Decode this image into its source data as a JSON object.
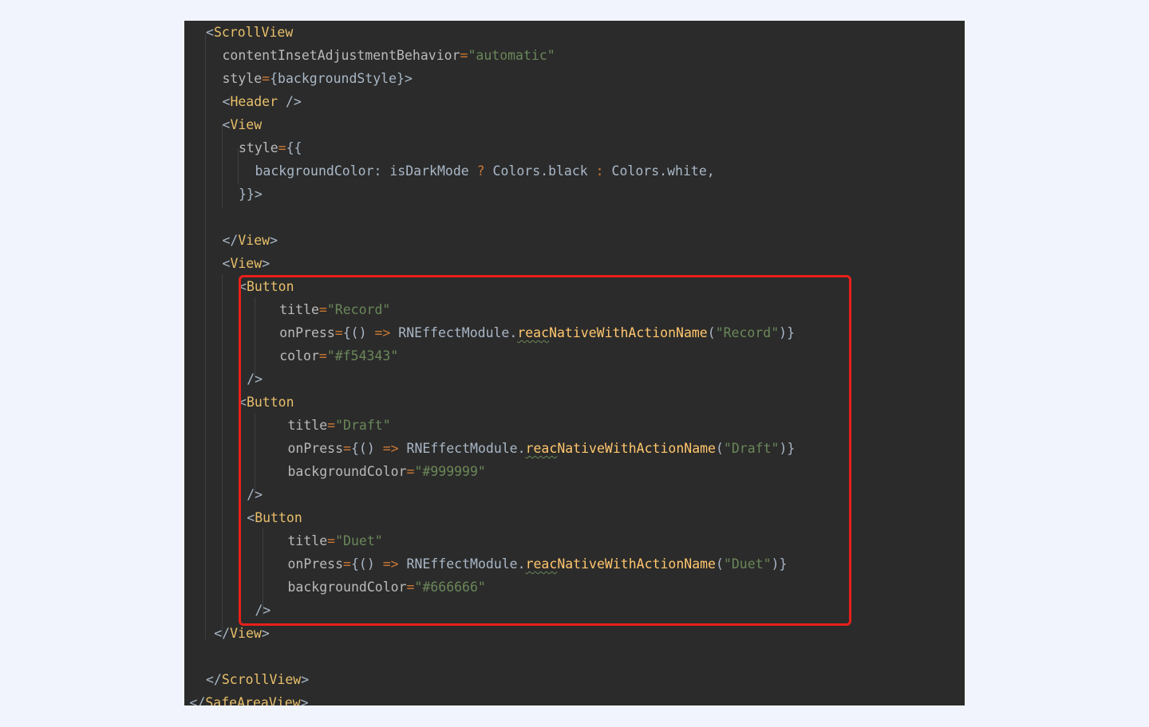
{
  "editor": {
    "lines": [
      {
        "indent": 0,
        "tokens": [
          {
            "t": "<",
            "c": "pun"
          },
          {
            "t": "ScrollView",
            "c": "tag"
          }
        ]
      },
      {
        "indent": 1,
        "tokens": [
          {
            "t": "contentInsetAdjustmentBehavior",
            "c": "attr"
          },
          {
            "t": "=",
            "c": "op"
          },
          {
            "t": "\"automatic\"",
            "c": "str"
          }
        ]
      },
      {
        "indent": 1,
        "tokens": [
          {
            "t": "style",
            "c": "attr"
          },
          {
            "t": "=",
            "c": "op"
          },
          {
            "t": "{backgroundStyle}>",
            "c": "pun"
          }
        ]
      },
      {
        "indent": 1,
        "tokens": [
          {
            "t": "<",
            "c": "pun"
          },
          {
            "t": "Header",
            "c": "tag"
          },
          {
            "t": " />",
            "c": "pun"
          }
        ]
      },
      {
        "indent": 1,
        "tokens": [
          {
            "t": "<",
            "c": "pun"
          },
          {
            "t": "View",
            "c": "tag"
          }
        ]
      },
      {
        "indent": 2,
        "tokens": [
          {
            "t": "style",
            "c": "attr"
          },
          {
            "t": "=",
            "c": "op"
          },
          {
            "t": "{{",
            "c": "pun"
          }
        ]
      },
      {
        "indent": 3,
        "tokens": [
          {
            "t": "backgroundColor: isDarkMode ",
            "c": "pun"
          },
          {
            "t": "?",
            "c": "op"
          },
          {
            "t": " Colors.black ",
            "c": "pun"
          },
          {
            "t": ":",
            "c": "op"
          },
          {
            "t": " Colors.white,",
            "c": "pun"
          }
        ]
      },
      {
        "indent": 2,
        "tokens": [
          {
            "t": "}}>",
            "c": "pun"
          }
        ]
      },
      {
        "indent": 0,
        "tokens": []
      },
      {
        "indent": 1,
        "tokens": [
          {
            "t": "</",
            "c": "pun"
          },
          {
            "t": "View",
            "c": "tag"
          },
          {
            "t": ">",
            "c": "pun"
          }
        ]
      },
      {
        "indent": 1,
        "tokens": [
          {
            "t": "<",
            "c": "pun"
          },
          {
            "t": "View",
            "c": "tag"
          },
          {
            "t": ">",
            "c": "pun"
          }
        ]
      },
      {
        "indent": 2,
        "tokens": [
          {
            "t": "<",
            "c": "pun"
          },
          {
            "t": "Button",
            "c": "tag"
          }
        ]
      },
      {
        "indent": 4.5,
        "tokens": [
          {
            "t": "title",
            "c": "attr"
          },
          {
            "t": "=",
            "c": "op"
          },
          {
            "t": "\"Record\"",
            "c": "str"
          }
        ]
      },
      {
        "indent": 4.5,
        "tokens": [
          {
            "t": "onPress",
            "c": "attr"
          },
          {
            "t": "=",
            "c": "op"
          },
          {
            "t": "{() ",
            "c": "pun"
          },
          {
            "t": "=>",
            "c": "op"
          },
          {
            "t": " RNEffectModule.",
            "c": "pun"
          },
          {
            "t": "reac",
            "c": "fn squig"
          },
          {
            "t": "NativeWithActionName",
            "c": "fn"
          },
          {
            "t": "(",
            "c": "pun"
          },
          {
            "t": "\"Record\"",
            "c": "str"
          },
          {
            "t": ")}",
            "c": "pun"
          }
        ]
      },
      {
        "indent": 4.5,
        "tokens": [
          {
            "t": "color",
            "c": "attr"
          },
          {
            "t": "=",
            "c": "op"
          },
          {
            "t": "\"#f54343\"",
            "c": "str"
          }
        ]
      },
      {
        "indent": 2.5,
        "tokens": [
          {
            "t": "/>",
            "c": "pun"
          }
        ]
      },
      {
        "indent": 2,
        "tokens": [
          {
            "t": "<",
            "c": "pun"
          },
          {
            "t": "Button",
            "c": "tag"
          }
        ]
      },
      {
        "indent": 5,
        "tokens": [
          {
            "t": "title",
            "c": "attr"
          },
          {
            "t": "=",
            "c": "op"
          },
          {
            "t": "\"Draft\"",
            "c": "str"
          }
        ]
      },
      {
        "indent": 5,
        "tokens": [
          {
            "t": "onPress",
            "c": "attr"
          },
          {
            "t": "=",
            "c": "op"
          },
          {
            "t": "{() ",
            "c": "pun"
          },
          {
            "t": "=>",
            "c": "op"
          },
          {
            "t": " RNEffectModule.",
            "c": "pun"
          },
          {
            "t": "reac",
            "c": "fn squig"
          },
          {
            "t": "NativeWithActionName",
            "c": "fn"
          },
          {
            "t": "(",
            "c": "pun"
          },
          {
            "t": "\"Draft\"",
            "c": "str"
          },
          {
            "t": ")}",
            "c": "pun"
          }
        ]
      },
      {
        "indent": 5,
        "tokens": [
          {
            "t": "backgroundColor",
            "c": "attr"
          },
          {
            "t": "=",
            "c": "op"
          },
          {
            "t": "\"#999999\"",
            "c": "str"
          }
        ]
      },
      {
        "indent": 2.5,
        "tokens": [
          {
            "t": "/>",
            "c": "pun"
          }
        ]
      },
      {
        "indent": 2.5,
        "tokens": [
          {
            "t": "<",
            "c": "pun"
          },
          {
            "t": "Button",
            "c": "tag"
          }
        ]
      },
      {
        "indent": 5,
        "tokens": [
          {
            "t": "title",
            "c": "attr"
          },
          {
            "t": "=",
            "c": "op"
          },
          {
            "t": "\"Duet\"",
            "c": "str"
          }
        ]
      },
      {
        "indent": 5,
        "tokens": [
          {
            "t": "onPress",
            "c": "attr"
          },
          {
            "t": "=",
            "c": "op"
          },
          {
            "t": "{() ",
            "c": "pun"
          },
          {
            "t": "=>",
            "c": "op"
          },
          {
            "t": " RNEffectModule.",
            "c": "pun"
          },
          {
            "t": "reac",
            "c": "fn squig"
          },
          {
            "t": "NativeWithActionName",
            "c": "fn"
          },
          {
            "t": "(",
            "c": "pun"
          },
          {
            "t": "\"Duet\"",
            "c": "str"
          },
          {
            "t": ")}",
            "c": "pun"
          }
        ]
      },
      {
        "indent": 5,
        "tokens": [
          {
            "t": "backgroundColor",
            "c": "attr"
          },
          {
            "t": "=",
            "c": "op"
          },
          {
            "t": "\"#666666\"",
            "c": "str"
          }
        ]
      },
      {
        "indent": 3,
        "tokens": [
          {
            "t": "/>",
            "c": "pun"
          }
        ]
      },
      {
        "indent": 0.5,
        "tokens": [
          {
            "t": "</",
            "c": "pun"
          },
          {
            "t": "View",
            "c": "tag"
          },
          {
            "t": ">",
            "c": "pun"
          }
        ]
      },
      {
        "indent": 0,
        "tokens": []
      },
      {
        "indent": 0,
        "tokens": [
          {
            "t": "</",
            "c": "pun"
          },
          {
            "t": "ScrollView",
            "c": "tag"
          },
          {
            "t": ">",
            "c": "pun"
          }
        ]
      },
      {
        "indent": -1,
        "tokens": [
          {
            "t": "</",
            "c": "pun"
          },
          {
            "t": "SafeAreaView",
            "c": "tag squig"
          },
          {
            "t": ">",
            "c": "pun"
          }
        ]
      }
    ]
  },
  "highlight": {
    "color": "#e8201a"
  },
  "colors": {
    "background": "#f1f4fd",
    "editor_bg": "#2b2b2b",
    "tag": "#e8bf6a",
    "attribute": "#bababa",
    "string": "#6a8759",
    "operator": "#cc7832",
    "method": "#ffc66d",
    "plain": "#a9b7c6"
  }
}
